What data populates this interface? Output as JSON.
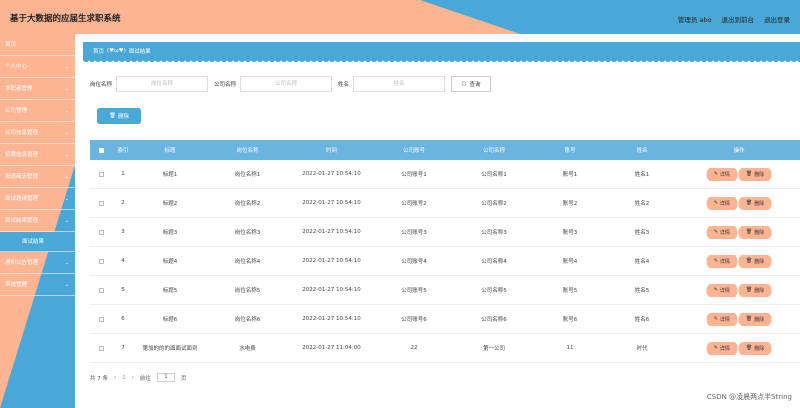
{
  "header": {
    "title": "基于大数据的应届生求职系统",
    "links": [
      "管理员 abo",
      "退出到前台",
      "退出登录"
    ]
  },
  "sidebar": {
    "items": [
      {
        "label": "首页",
        "chevron": false
      },
      {
        "label": "个人中心",
        "chevron": true
      },
      {
        "label": "求职者管理",
        "chevron": true
      },
      {
        "label": "公司管理",
        "chevron": true
      },
      {
        "label": "公司信息管理",
        "chevron": true
      },
      {
        "label": "招聘信息管理",
        "chevron": true
      },
      {
        "label": "投递简历管理",
        "chevron": true
      },
      {
        "label": "面试邀请管理",
        "chevron": true
      },
      {
        "label": "面试结果管理",
        "chevron": true
      },
      {
        "label": "面试结果",
        "chevron": false,
        "sub": true
      },
      {
        "label": "通知公告管理",
        "chevron": true
      },
      {
        "label": "系统管理",
        "chevron": true
      }
    ]
  },
  "breadcrumb": {
    "home": "首页",
    "sep": "(♥ω♥)",
    "current": "面试结果"
  },
  "search": {
    "job_label": "岗位名称",
    "job_placeholder": "岗位名称",
    "company_label": "公司名称",
    "company_placeholder": "公司名称",
    "name_label": "姓名",
    "name_placeholder": "姓名",
    "query_button": "查询"
  },
  "toolbar": {
    "delete_label": "删除"
  },
  "table": {
    "headers": [
      "索引",
      "标题",
      "岗位名称",
      "时间",
      "公司账号",
      "公司名称",
      "账号",
      "姓名",
      "操作"
    ],
    "rows": [
      [
        "1",
        "标题1",
        "岗位名称1",
        "2022-01-27 10:54:10",
        "公司账号1",
        "公司名称1",
        "账号1",
        "姓名1"
      ],
      [
        "2",
        "标题2",
        "岗位名称2",
        "2022-01-27 10:54:10",
        "公司账号2",
        "公司名称2",
        "账号2",
        "姓名2"
      ],
      [
        "3",
        "标题3",
        "岗位名称3",
        "2022-01-27 10:54:10",
        "公司账号3",
        "公司名称3",
        "账号3",
        "姓名3"
      ],
      [
        "4",
        "标题4",
        "岗位名称4",
        "2022-01-27 10:54:10",
        "公司账号4",
        "公司名称4",
        "账号4",
        "姓名4"
      ],
      [
        "5",
        "标题5",
        "岗位名称5",
        "2022-01-27 10:54:10",
        "公司账号5",
        "公司名称5",
        "账号5",
        "姓名5"
      ],
      [
        "6",
        "标题6",
        "岗位名称6",
        "2022-01-27 10:54:10",
        "公司账号6",
        "公司名称6",
        "账号6",
        "姓名6"
      ],
      [
        "7",
        "第加的的的面面试面到",
        "水电费",
        "2022-01-27 11:04:00",
        "22",
        "第一公司",
        "11",
        "时代"
      ]
    ],
    "detail_label": "详情",
    "delete_label": "删除"
  },
  "pager": {
    "total": "共 7 条",
    "prev": "‹",
    "current": "1",
    "next": "›",
    "goto_label": "前往",
    "goto_value": "1",
    "page_suffix": "页"
  },
  "watermark": "CSDN @凌晨两点半String",
  "colors": {
    "salmon": "#fdb493",
    "blue": "#4aa8d8",
    "table_header": "#6ab4e0"
  }
}
